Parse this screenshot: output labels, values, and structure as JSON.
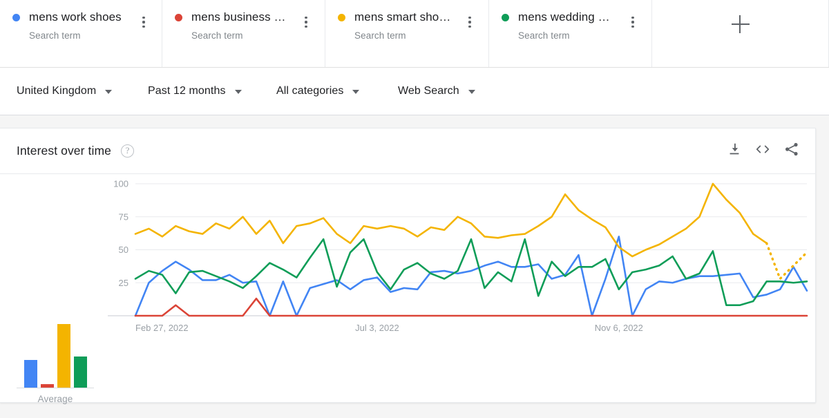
{
  "terms": [
    {
      "title": "mens work shoes",
      "subtitle": "Search term",
      "color": "#4285f4",
      "menu_icon": "kebab-menu-icon"
    },
    {
      "title": "mens business sh…",
      "subtitle": "Search term",
      "color": "#db4437",
      "menu_icon": "kebab-menu-icon"
    },
    {
      "title": "mens smart shoes",
      "subtitle": "Search term",
      "color": "#f4b400",
      "menu_icon": "kebab-menu-icon"
    },
    {
      "title": "mens wedding sho…",
      "subtitle": "Search term",
      "color": "#0f9d58",
      "menu_icon": "kebab-menu-icon"
    }
  ],
  "add_term": {
    "icon": "plus-icon",
    "label": "+"
  },
  "filters": [
    {
      "label": "United Kingdom",
      "icon": "chevron-down-icon"
    },
    {
      "label": "Past 12 months",
      "icon": "chevron-down-icon"
    },
    {
      "label": "All categories",
      "icon": "chevron-down-icon"
    },
    {
      "label": "Web Search",
      "icon": "chevron-down-icon"
    }
  ],
  "card": {
    "title": "Interest over time",
    "help_icon": "help-circle-icon",
    "help_glyph": "?",
    "actions": [
      {
        "name": "download-icon",
        "tooltip": "Download"
      },
      {
        "name": "embed-code-icon",
        "tooltip": "Embed"
      },
      {
        "name": "share-icon",
        "tooltip": "Share"
      }
    ]
  },
  "average": {
    "label": "Average",
    "values": [
      25,
      3,
      57,
      28
    ],
    "colors": [
      "#4285f4",
      "#db4437",
      "#f4b400",
      "#0f9d58"
    ]
  },
  "chart_data": {
    "type": "line",
    "title": "Interest over time",
    "xlabel": "",
    "ylabel": "",
    "ylim": [
      0,
      100
    ],
    "yticks": [
      25,
      50,
      75,
      100
    ],
    "grid": true,
    "legend": "top",
    "xticks": [
      "Feb 27, 2022",
      "Jul 3, 2022",
      "Nov 6, 2022"
    ],
    "xtick_index": [
      0,
      18,
      36
    ],
    "x": [
      "Feb 27, 2022",
      "Mar 6, 2022",
      "Mar 13, 2022",
      "Mar 20, 2022",
      "Mar 27, 2022",
      "Apr 3, 2022",
      "Apr 10, 2022",
      "Apr 17, 2022",
      "Apr 24, 2022",
      "May 1, 2022",
      "May 8, 2022",
      "May 15, 2022",
      "May 22, 2022",
      "May 29, 2022",
      "Jun 5, 2022",
      "Jun 12, 2022",
      "Jun 19, 2022",
      "Jun 26, 2022",
      "Jul 3, 2022",
      "Jul 10, 2022",
      "Jul 17, 2022",
      "Jul 24, 2022",
      "Jul 31, 2022",
      "Aug 7, 2022",
      "Aug 14, 2022",
      "Aug 21, 2022",
      "Aug 28, 2022",
      "Sep 4, 2022",
      "Sep 11, 2022",
      "Sep 18, 2022",
      "Sep 25, 2022",
      "Oct 2, 2022",
      "Oct 9, 2022",
      "Oct 16, 2022",
      "Oct 23, 2022",
      "Oct 30, 2022",
      "Nov 6, 2022",
      "Nov 13, 2022",
      "Nov 20, 2022",
      "Nov 27, 2022",
      "Dec 4, 2022",
      "Dec 11, 2022",
      "Dec 18, 2022",
      "Dec 25, 2022",
      "Jan 1, 2023",
      "Jan 8, 2023",
      "Jan 15, 2023",
      "Jan 22, 2023",
      "Jan 29, 2023",
      "Feb 5, 2023",
      "Feb 12, 2023"
    ],
    "series": [
      {
        "name": "mens work shoes",
        "color": "#4285f4",
        "values": [
          0,
          25,
          34,
          41,
          35,
          27,
          27,
          31,
          25,
          26,
          0,
          26,
          0,
          21,
          24,
          27,
          20,
          27,
          29,
          18,
          21,
          20,
          33,
          34,
          32,
          34,
          38,
          41,
          37,
          37,
          39,
          28,
          31,
          46,
          0,
          28,
          60,
          0,
          20,
          26,
          25,
          28,
          30,
          30,
          31,
          32,
          14,
          16,
          20,
          37,
          19
        ],
        "dashed_tail": false
      },
      {
        "name": "mens business shoes",
        "color": "#db4437",
        "values": [
          0,
          0,
          0,
          8,
          0,
          0,
          0,
          0,
          0,
          13,
          0,
          0,
          0,
          0,
          0,
          0,
          0,
          0,
          0,
          0,
          0,
          0,
          0,
          0,
          0,
          0,
          0,
          0,
          0,
          0,
          0,
          0,
          0,
          0,
          0,
          0,
          0,
          0,
          0,
          0,
          0,
          0,
          0,
          0,
          0,
          0,
          0,
          0,
          0,
          0,
          0
        ],
        "dashed_tail": false
      },
      {
        "name": "mens smart shoes",
        "color": "#f4b400",
        "values": [
          62,
          66,
          60,
          68,
          64,
          62,
          70,
          66,
          75,
          62,
          72,
          55,
          68,
          70,
          74,
          62,
          55,
          68,
          66,
          68,
          66,
          60,
          67,
          65,
          75,
          70,
          60,
          59,
          61,
          62,
          68,
          75,
          92,
          80,
          73,
          67,
          52,
          45,
          50,
          54,
          60,
          66,
          75,
          100,
          88,
          78,
          62,
          55,
          28,
          38,
          48
        ],
        "dashed_tail": true,
        "dashed_from": 47
      },
      {
        "name": "mens wedding shoes",
        "color": "#0f9d58",
        "values": [
          28,
          34,
          31,
          17,
          33,
          34,
          30,
          26,
          21,
          30,
          40,
          35,
          29,
          44,
          58,
          22,
          48,
          58,
          33,
          20,
          35,
          40,
          32,
          28,
          34,
          58,
          21,
          33,
          26,
          58,
          15,
          41,
          30,
          37,
          37,
          43,
          20,
          33,
          35,
          38,
          45,
          28,
          32,
          49,
          8,
          8,
          11,
          26,
          26,
          25,
          26
        ],
        "dashed_tail": false
      }
    ]
  }
}
